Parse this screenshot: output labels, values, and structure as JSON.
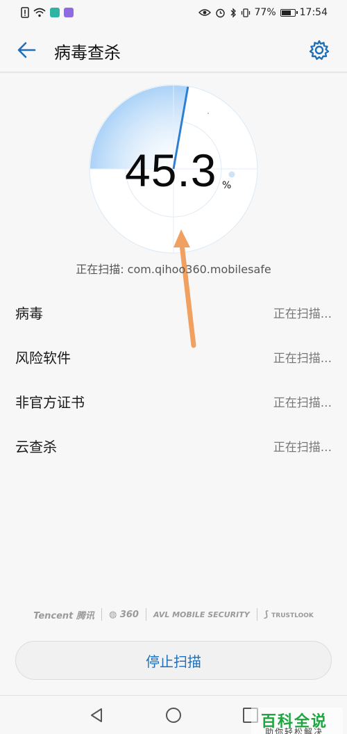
{
  "status_bar": {
    "battery_percent": "77%",
    "battery_level": 0.77,
    "time": "17:54",
    "icons": [
      "alert-icon",
      "wifi-icon",
      "sim-icon",
      "app-icon",
      "eye-icon",
      "alarm-icon",
      "bluetooth-icon",
      "vibrate-icon",
      "battery-icon"
    ]
  },
  "header": {
    "title": "病毒查杀",
    "back_icon": "arrow-left-icon",
    "settings_icon": "gear-icon",
    "accent_color": "#1e6fb8"
  },
  "scan": {
    "percent_value": "45.3",
    "percent_unit": "%",
    "path_text": "正在扫描: com.qihoo360.mobilesafe"
  },
  "items": [
    {
      "label": "病毒",
      "status": "正在扫描..."
    },
    {
      "label": "风险软件",
      "status": "正在扫描..."
    },
    {
      "label": "非官方证书",
      "status": "正在扫描..."
    },
    {
      "label": "云查杀",
      "status": "正在扫描..."
    }
  ],
  "partners": {
    "tencent": "Tencent 腾讯",
    "q360": "360",
    "avl": "AVL MOBILE SECURITY",
    "trustlook": "TRUSTLOOK"
  },
  "stop_button_label": "停止扫描",
  "nav": {
    "back_icon": "nav-back-icon",
    "home_icon": "nav-home-icon",
    "recent_icon": "nav-recent-icon"
  },
  "watermark": {
    "main": "百科全说",
    "sub": "助你轻松解决"
  },
  "annotation": {
    "arrow_color": "#f0a060"
  }
}
